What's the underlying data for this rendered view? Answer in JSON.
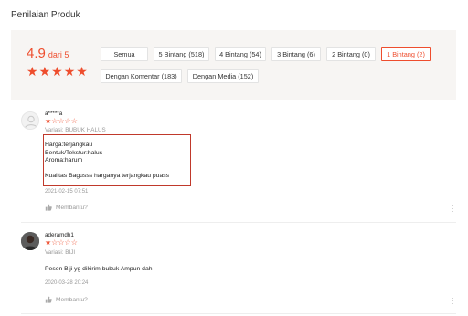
{
  "page": {
    "title": "Penilaian Produk"
  },
  "rating": {
    "score": "4.9",
    "suffix": "dari 5",
    "stars": 5
  },
  "filters": {
    "all": "Semua",
    "five": "5 Bintang (518)",
    "four": "4 Bintang (54)",
    "three": "3 Bintang (6)",
    "two": "2 Bintang (0)",
    "one": "1 Bintang (2)",
    "with_comment": "Dengan Komentar (183)",
    "with_media": "Dengan Media (152)",
    "active": "one"
  },
  "colors": {
    "accent": "#ee4d2d",
    "highlight_box": "#c0392b"
  },
  "reviews": [
    {
      "username": "a*****a",
      "rating": 1,
      "variation": "Variasi: BUBUK HALUS",
      "lines": [
        "Harga:terjangkau",
        "Bentuk/Tekstur:halus",
        "Aroma:harum",
        "Kualitas Bagusss harganya terjangkau puass"
      ],
      "timestamp": "2021-02-15 07:51",
      "helpful": "Membantu?",
      "avatar": "default-avatar-icon"
    },
    {
      "username": "aderamdh1",
      "rating": 1,
      "variation": "Variasi: BIJI",
      "lines": [
        "Pesen Biji yg dikirim bubuk Ampun dah"
      ],
      "timestamp": "2020-03-28 20:24",
      "helpful": "Membantu?",
      "avatar": "user-photo-avatar"
    }
  ]
}
